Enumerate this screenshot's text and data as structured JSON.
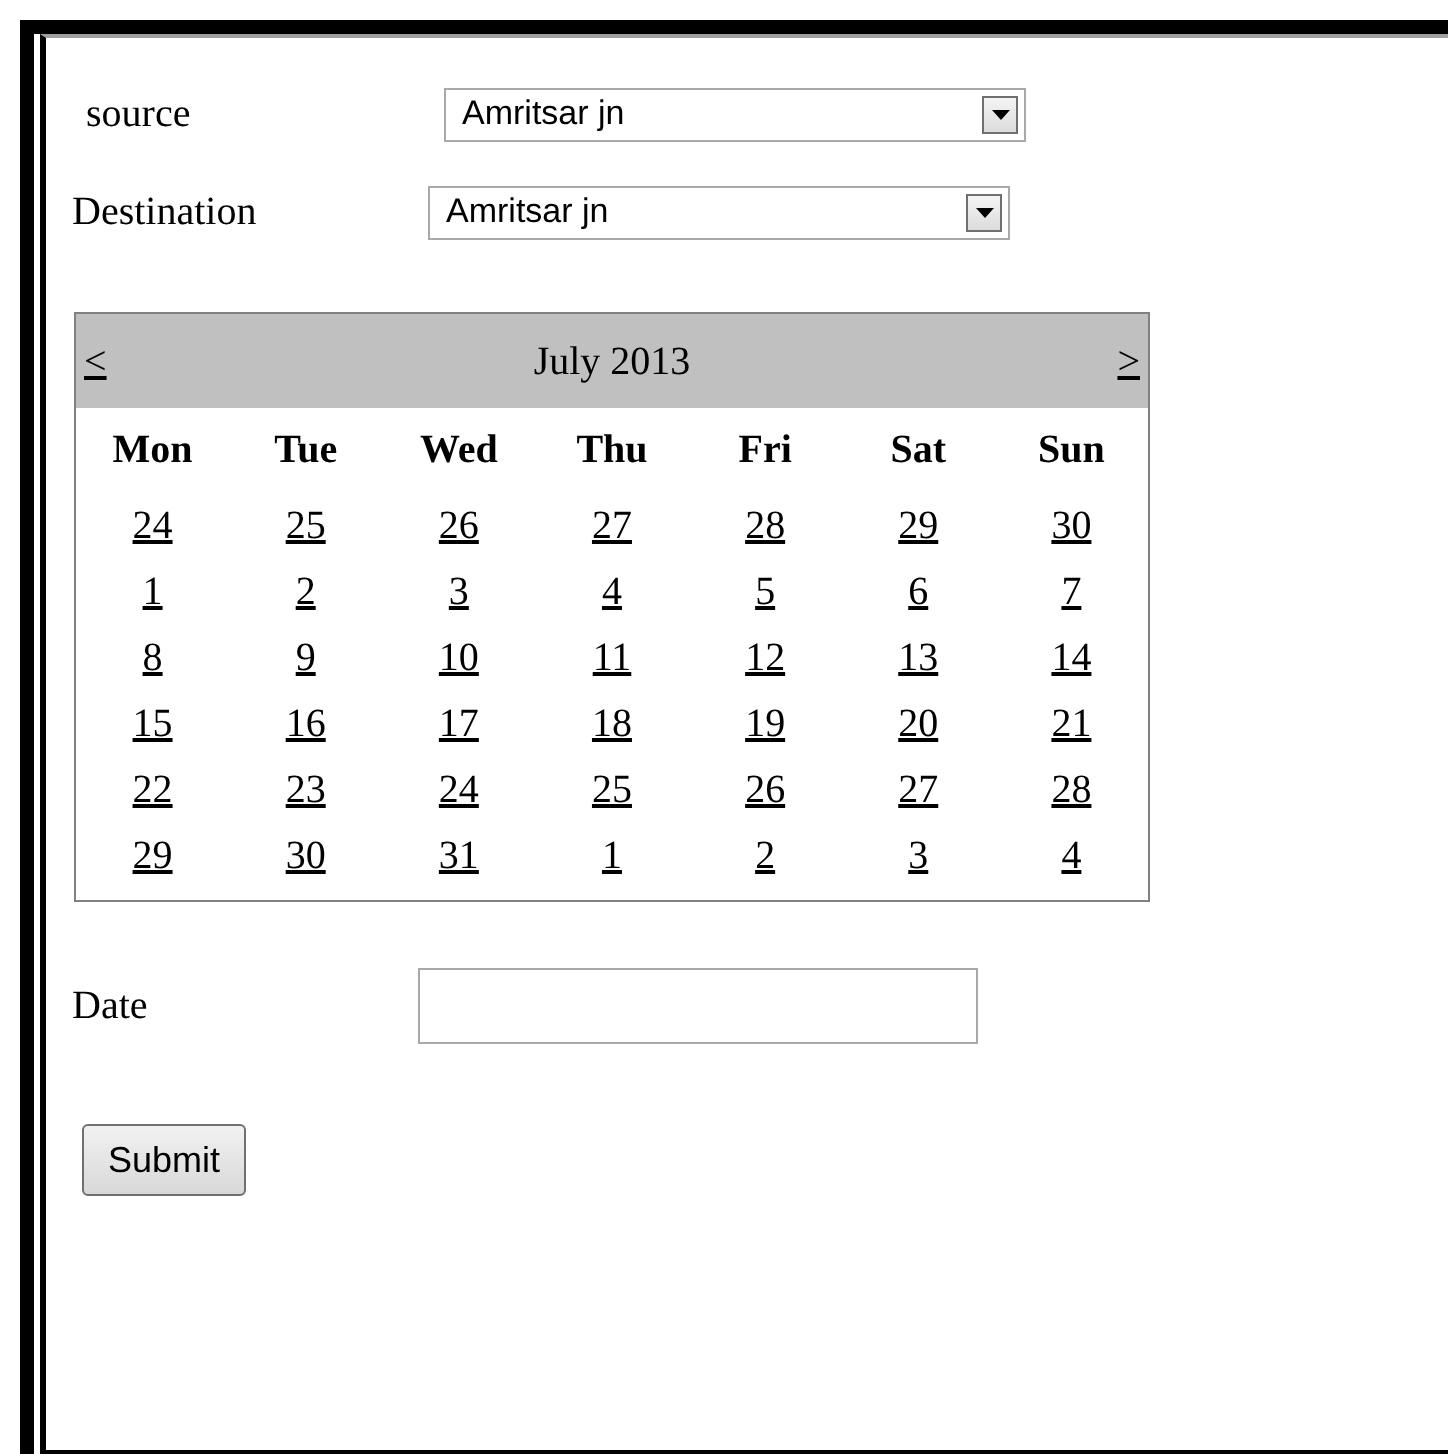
{
  "source": {
    "label": "source",
    "value": "Amritsar jn"
  },
  "destination": {
    "label": "Destination",
    "value": "Amritsar jn"
  },
  "calendar": {
    "prev": "<",
    "title": "July 2013",
    "next": ">",
    "weekdays": [
      "Mon",
      "Tue",
      "Wed",
      "Thu",
      "Fri",
      "Sat",
      "Sun"
    ],
    "weeks": [
      [
        "24",
        "25",
        "26",
        "27",
        "28",
        "29",
        "30"
      ],
      [
        "1",
        "2",
        "3",
        "4",
        "5",
        "6",
        "7"
      ],
      [
        "8",
        "9",
        "10",
        "11",
        "12",
        "13",
        "14"
      ],
      [
        "15",
        "16",
        "17",
        "18",
        "19",
        "20",
        "21"
      ],
      [
        "22",
        "23",
        "24",
        "25",
        "26",
        "27",
        "28"
      ],
      [
        "29",
        "30",
        "31",
        "1",
        "2",
        "3",
        "4"
      ]
    ]
  },
  "date": {
    "label": "Date"
  },
  "submit": "Submit"
}
